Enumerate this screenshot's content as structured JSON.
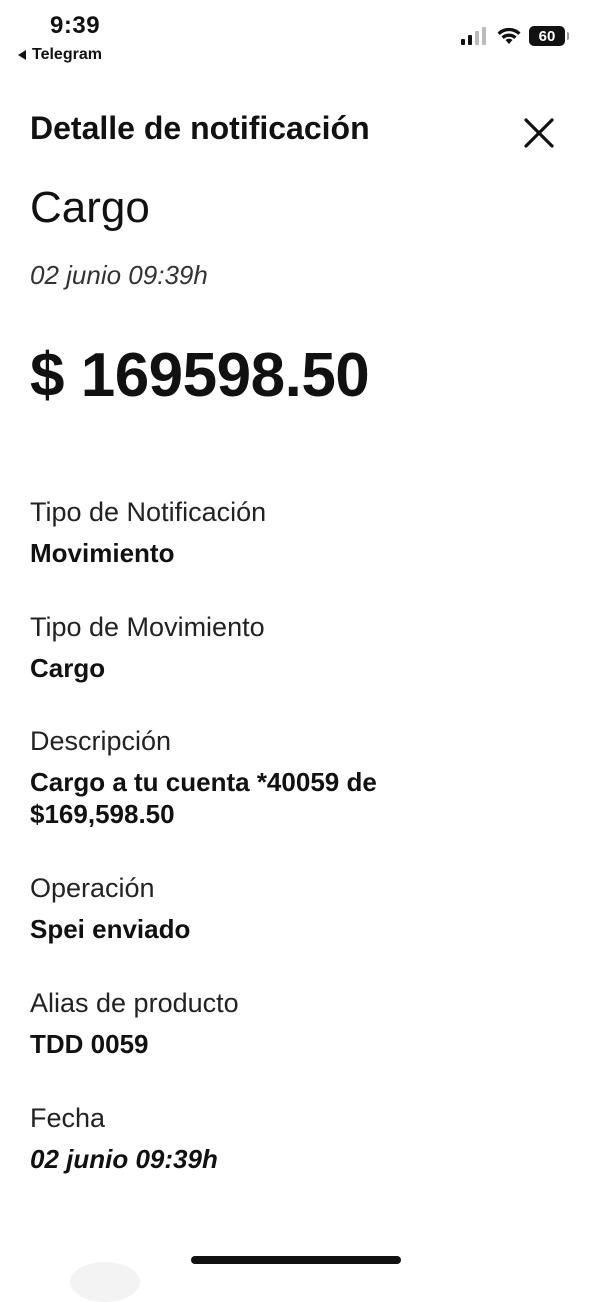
{
  "status_bar": {
    "time": "9:39",
    "back_app": "Telegram",
    "battery": "60"
  },
  "header": {
    "title": "Detalle de notificación"
  },
  "summary": {
    "title": "Cargo",
    "date": "02 junio 09:39h",
    "amount": "$ 169598.50"
  },
  "details": [
    {
      "label": "Tipo de Notificación",
      "value": "Movimiento"
    },
    {
      "label": "Tipo de Movimiento",
      "value": "Cargo"
    },
    {
      "label": "Descripción",
      "value": "Cargo a tu cuenta *40059 de\n$169,598.50"
    },
    {
      "label": "Operación",
      "value": "Spei enviado"
    },
    {
      "label": "Alias de producto",
      "value": "TDD 0059"
    },
    {
      "label": "Fecha",
      "value": "02 junio 09:39h"
    }
  ]
}
